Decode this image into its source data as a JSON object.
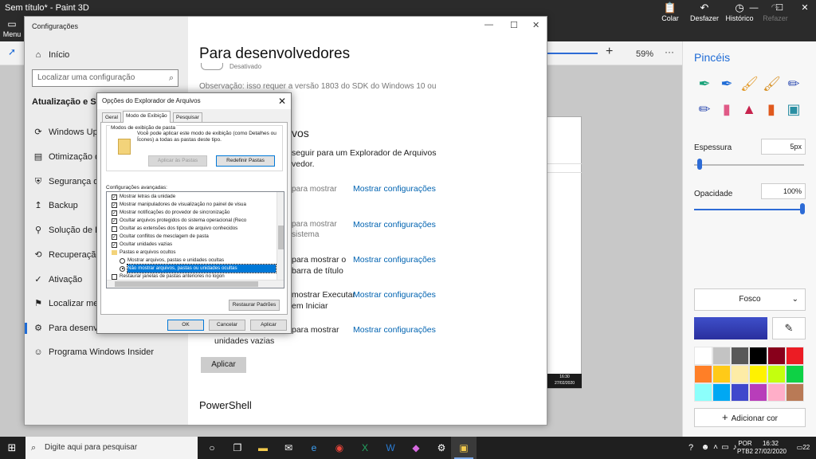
{
  "paint3d": {
    "title": "Sem título* - Paint 3D",
    "menu_label": "Menu",
    "ribbon": {
      "paste": "Colar",
      "undo": "Desfazer",
      "history": "Histórico",
      "redo": "Refazer"
    },
    "zoom": "59%",
    "panel_title": "Pincéis",
    "thickness_label": "Espessura",
    "thickness_value": "5px",
    "opacity_label": "Opacidade",
    "opacity_value": "100%",
    "finish_value": "Fosco",
    "add_color_label": "Adicionar cor",
    "canvas_clock": "16:30",
    "canvas_date": "27/02/2020",
    "palette": [
      "#ffffff",
      "#c3c3c3",
      "#585858",
      "#000000",
      "#88001b",
      "#ec1c24",
      "#ff7f27",
      "#ffca18",
      "#fdeca6",
      "#fff200",
      "#c4ff0e",
      "#0ed145",
      "#8cfffb",
      "#00a8f3",
      "#3f48cc",
      "#b83dba",
      "#ffaec8",
      "#b97a56"
    ]
  },
  "settings": {
    "window_title": "Configurações",
    "home": "Início",
    "search_placeholder": "Localizar uma configuração",
    "section": "Atualização e Segurança",
    "nav": [
      "Windows Update",
      "Otimização de Entrega",
      "Segurança do Windows",
      "Backup",
      "Solução de Problemas",
      "Recuperação",
      "Ativação",
      "Localizar meu dispositivo",
      "Para desenvolvedores",
      "Programa Windows Insider"
    ],
    "page_title": "Para desenvolvedores",
    "disabled_label": "Desativado",
    "observation": "Observação: isso requer a versão 1803 do SDK do Windows 10 ou",
    "heading_fragment": "vos",
    "explorer_text": [
      "seguir para um Explorador de Arquivos",
      "vedor."
    ],
    "row_texts": [
      "para mostrar",
      "para mostrar",
      "sistema",
      "para mostrar o",
      "barra de título",
      "mostrar Executar",
      "em Iniciar",
      "para mostrar",
      "unidades vazias"
    ],
    "show_settings": "Mostrar configurações",
    "apply": "Aplicar",
    "powershell": "PowerShell"
  },
  "folder_options": {
    "title": "Opções do Explorador de Arquivos",
    "tabs": [
      "Geral",
      "Modo de Exibição",
      "Pesquisar"
    ],
    "group_title": "Modos de exibição de pasta",
    "group_text": "Você pode aplicar este modo de exibição (como Detalhes ou Ícones) a todas as pastas deste tipo.",
    "apply_to_folders": "Aplicar às Pastas",
    "reset_folders": "Redefinir Pastas",
    "advanced_label": "Configurações avançadas:",
    "items": [
      {
        "kind": "check",
        "checked": true,
        "label": "Mostrar letras da unidade"
      },
      {
        "kind": "check",
        "checked": true,
        "label": "Mostrar manipuladores de visualização no painel de visua"
      },
      {
        "kind": "check",
        "checked": true,
        "label": "Mostrar notificações do provedor de sincronização"
      },
      {
        "kind": "check",
        "checked": true,
        "label": "Ocultar arquivos protegidos do sistema operacional (Reco"
      },
      {
        "kind": "check",
        "checked": false,
        "label": "Ocultar as extensões dos tipos de arquivo conhecidos"
      },
      {
        "kind": "check",
        "checked": true,
        "label": "Ocultar conflitos de mesclagem de pasta"
      },
      {
        "kind": "check",
        "checked": true,
        "label": "Ocultar unidades vazias"
      },
      {
        "kind": "folder",
        "label": "Pastas e arquivos ocultos"
      },
      {
        "kind": "radio",
        "checked": false,
        "label": "Mostrar arquivos, pastas e unidades ocultas"
      },
      {
        "kind": "radio",
        "checked": true,
        "label": "Não mostrar arquivos, pastas ou unidades ocultas"
      },
      {
        "kind": "check",
        "checked": false,
        "label": "Restaurar janelas de pastas anteriores no logon"
      }
    ],
    "restore_defaults": "Restaurar Padrões",
    "ok": "OK",
    "cancel": "Cancelar",
    "apply": "Aplicar"
  },
  "taskbar": {
    "search_placeholder": "Digite aqui para pesquisar",
    "lang": "POR",
    "layout": "PTB2",
    "time": "16:32",
    "date": "27/02/2020",
    "notifications": "22"
  }
}
